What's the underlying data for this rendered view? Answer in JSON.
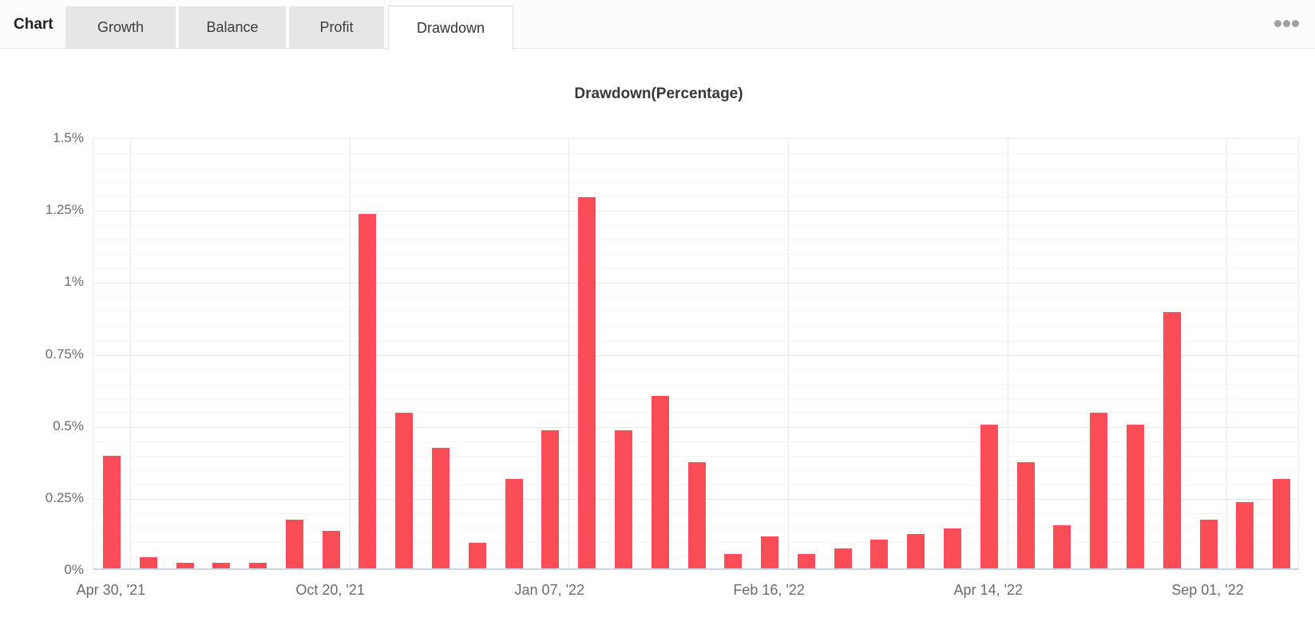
{
  "header": {
    "section_label": "Chart",
    "tabs": [
      {
        "label": "Growth",
        "active": false
      },
      {
        "label": "Balance",
        "active": false
      },
      {
        "label": "Profit",
        "active": false
      },
      {
        "label": "Drawdown",
        "active": true
      }
    ],
    "more_options_icon": "ellipsis-icon"
  },
  "chart_data": {
    "type": "bar",
    "title": "Drawdown(Percentage)",
    "bar_color": "#fa4d58",
    "ylim": [
      0,
      1.5
    ],
    "grid": {
      "minor_step": 0.05,
      "major_step": 0.25
    },
    "legend": "none",
    "y_ticks": [
      {
        "value": 1.5,
        "label": "1.5%"
      },
      {
        "value": 1.25,
        "label": "1.25%"
      },
      {
        "value": 1.0,
        "label": "1%"
      },
      {
        "value": 0.75,
        "label": "0.75%"
      },
      {
        "value": 0.5,
        "label": "0.5%"
      },
      {
        "value": 0.25,
        "label": "0.25%"
      },
      {
        "value": 0,
        "label": "0%"
      }
    ],
    "x_ticks": [
      {
        "index": 0,
        "label": "Apr 30, '21"
      },
      {
        "index": 6,
        "label": "Oct 20, '21"
      },
      {
        "index": 12,
        "label": "Jan 07, '22"
      },
      {
        "index": 18,
        "label": "Feb 16, '22"
      },
      {
        "index": 24,
        "label": "Apr 14, '22"
      },
      {
        "index": 30,
        "label": "Sep 01, '22"
      }
    ],
    "values": [
      0.39,
      0.04,
      0.02,
      0.02,
      0.02,
      0.17,
      0.13,
      1.23,
      0.54,
      0.42,
      0.09,
      0.31,
      0.48,
      1.29,
      0.48,
      0.6,
      0.37,
      0.05,
      0.11,
      0.05,
      0.07,
      0.1,
      0.12,
      0.14,
      0.5,
      0.37,
      0.15,
      0.54,
      0.5,
      0.89,
      0.17,
      0.23,
      0.31
    ]
  }
}
